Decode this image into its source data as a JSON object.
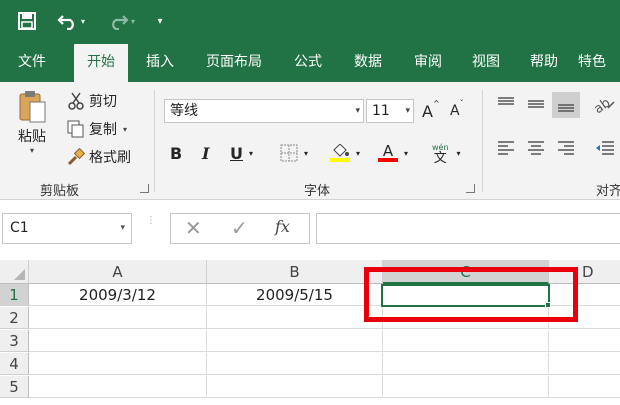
{
  "quick_access": {
    "save_icon": "save-icon",
    "undo_icon": "undo-icon",
    "redo_icon": "redo-icon",
    "customize_icon": "customize-qat-icon"
  },
  "ribbon_tabs": [
    {
      "label": "文件"
    },
    {
      "label": "开始"
    },
    {
      "label": "插入"
    },
    {
      "label": "页面布局"
    },
    {
      "label": "公式"
    },
    {
      "label": "数据"
    },
    {
      "label": "审阅"
    },
    {
      "label": "视图"
    },
    {
      "label": "帮助"
    },
    {
      "label": "特色"
    }
  ],
  "clipboard": {
    "paste_label": "粘贴",
    "cut_label": "剪切",
    "copy_label": "复制",
    "format_painter_label": "格式刷",
    "group_label": "剪贴板"
  },
  "font": {
    "font_name": "等线",
    "font_size": "11",
    "grow_label": "A",
    "shrink_label": "A",
    "bold_label": "B",
    "italic_label": "I",
    "underline_label": "U",
    "font_color_label": "A",
    "phonetic_top": "wén",
    "phonetic_bottom": "文",
    "group_label": "字体",
    "highlight_color": "#ffff00",
    "font_color": "#ff0000"
  },
  "alignment": {
    "group_label": "对齐"
  },
  "formula_bar": {
    "name_box": "C1",
    "fx_label": "fx",
    "cancel_label": "✕",
    "enter_label": "✓",
    "formula": ""
  },
  "sheet": {
    "columns": [
      "A",
      "B",
      "C",
      "D"
    ],
    "rows": [
      "1",
      "2",
      "3",
      "4",
      "5"
    ],
    "cells": {
      "A1": "2009/3/12",
      "B1": "2009/5/15"
    },
    "selected_cell": "C1"
  },
  "colors": {
    "excel_green": "#217346",
    "highlight_box": "#e8000b"
  }
}
